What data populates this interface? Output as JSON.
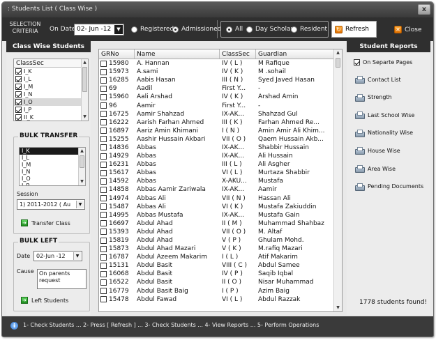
{
  "window": {
    "title": ": Students List ( Class Wise )",
    "close_glyph": "x"
  },
  "criteria": {
    "label": "SELECTION CRITERIA",
    "ondate_label": "On Date",
    "date_value": "02- Jun -12",
    "status_options": [
      {
        "label": "Registered",
        "selected": false
      },
      {
        "label": "Admissioned",
        "selected": true
      }
    ],
    "scope_options": [
      {
        "label": "All",
        "selected": true
      },
      {
        "label": "Day Scholar",
        "selected": false
      },
      {
        "label": "Resident",
        "selected": false
      }
    ],
    "refresh_label": "Refresh",
    "close_label": "Close"
  },
  "left": {
    "title": "Class Wise Students",
    "classsec_header": "ClassSec",
    "classes": [
      {
        "label": "I_K",
        "checked": true
      },
      {
        "label": "I_L",
        "checked": true
      },
      {
        "label": "I_M",
        "checked": true
      },
      {
        "label": "I_N",
        "checked": true
      },
      {
        "label": "I_O",
        "checked": true
      },
      {
        "label": "I_P",
        "checked": true
      },
      {
        "label": "II_K",
        "checked": true
      }
    ],
    "bulk_transfer": {
      "title": "BULK TRANSFER",
      "list": [
        "I_K",
        "I_L",
        "I_M",
        "I_N",
        "I_O",
        "I_P"
      ],
      "session_label": "Session",
      "session_value": "1) 2011-2012 ( Au",
      "button_label": "Transfer Class"
    },
    "bulk_left": {
      "title": "BULK LEFT",
      "date_label": "Date",
      "date_value": "02-Jun -12",
      "cause_label": "Cause",
      "cause_value": "On parents request",
      "button_label": "Left Students"
    }
  },
  "grid": {
    "headers": [
      "GRNo",
      "Name",
      "ClassSec",
      "Guardian"
    ],
    "rows": [
      [
        "15980",
        "A. Hannan",
        "IV ( L )",
        "M Rafique"
      ],
      [
        "15973",
        "A.sami",
        "IV ( K )",
        "M .sohail"
      ],
      [
        "16285",
        "Aabis Hasan",
        "III ( N )",
        "Syed Javed Hasan"
      ],
      [
        "69",
        "Aadil",
        "First Y...",
        "-"
      ],
      [
        "15960",
        "Aali Arshad",
        "IV ( K )",
        "Arshad Amin"
      ],
      [
        "96",
        "Aamir",
        "First Y...",
        "-"
      ],
      [
        "16725",
        "Aamir Shahzad",
        "IX-AK...",
        "Shahzad Gul"
      ],
      [
        "16222",
        "Aarish Farhan Ahmed",
        "III ( K )",
        "Farhan Ahmed Re..."
      ],
      [
        "16897",
        "Aariz Amin Khimani",
        "I ( N )",
        "Amin Amir Ali Khim..."
      ],
      [
        "15255",
        "Aashir Hussain Akbari",
        "VII ( O )",
        "Qaem Hussain Akb..."
      ],
      [
        "14836",
        "Abbas",
        "IX-AK...",
        "Shabbir Hussain"
      ],
      [
        "14929",
        "Abbas",
        "IX-AK...",
        "Ali Hussain"
      ],
      [
        "16231",
        "Abbas",
        "III ( L )",
        "Ali Asgher"
      ],
      [
        "15617",
        "Abbas",
        "VI ( L )",
        "Murtaza Shabbir"
      ],
      [
        "14592",
        "Abbas",
        "X-AKU...",
        "Mustafa"
      ],
      [
        "14858",
        "Abbas Aamir Zariwala",
        "IX-AK...",
        "Aamir"
      ],
      [
        "14974",
        "Abbas Ali",
        "VII ( N )",
        "Hassan Ali"
      ],
      [
        "15487",
        "Abbas Ali",
        "VI ( K )",
        "Mustafa Zakiuddin"
      ],
      [
        "14995",
        "Abbas Mustafa",
        "IX-AK...",
        "Mustafa Gain"
      ],
      [
        "16697",
        "Abdul Ahad",
        "II ( M )",
        "Muhammad Shahbaz"
      ],
      [
        "15393",
        "Abdul Ahad",
        "VII ( O )",
        "M. Altaf"
      ],
      [
        "15819",
        "Abdul Ahad",
        "V ( P )",
        "Ghulam Mohd."
      ],
      [
        "15873",
        "Abdul Ahad Mazari",
        "V ( K )",
        "M.rafiq Mazari"
      ],
      [
        "16787",
        "Abdul Azeem Makarim",
        "I ( L )",
        "Atif Makarim"
      ],
      [
        "15131",
        "Abdul Basit",
        "VIII ( C )",
        "Abdul Samee"
      ],
      [
        "16068",
        "Abdul Basit",
        "IV ( P )",
        "Saqib Iqbal"
      ],
      [
        "16522",
        "Abdul Basit",
        "II ( O )",
        "Nisar Muhammad"
      ],
      [
        "16779",
        "Abdul Basit Baig",
        "I ( P )",
        "Azim Baig"
      ],
      [
        "15478",
        "Abdul Fawad",
        "VI ( L )",
        "Abdul Razzak"
      ]
    ]
  },
  "right": {
    "title": "Student Reports",
    "separate_pages_label": "On Separte Pages",
    "separate_pages_checked": true,
    "reports": [
      "Contact List",
      "Strength",
      "Last School Wise",
      "Nationality Wise",
      "House Wise",
      "Area Wise",
      "Pending Documents"
    ],
    "count_text": "1778 students found!"
  },
  "status": {
    "steps": "1- Check Students ... 2- Press [ Refresh ] ... 3- Check Students ... 4- View Reports ... 5- Perform Operations"
  }
}
